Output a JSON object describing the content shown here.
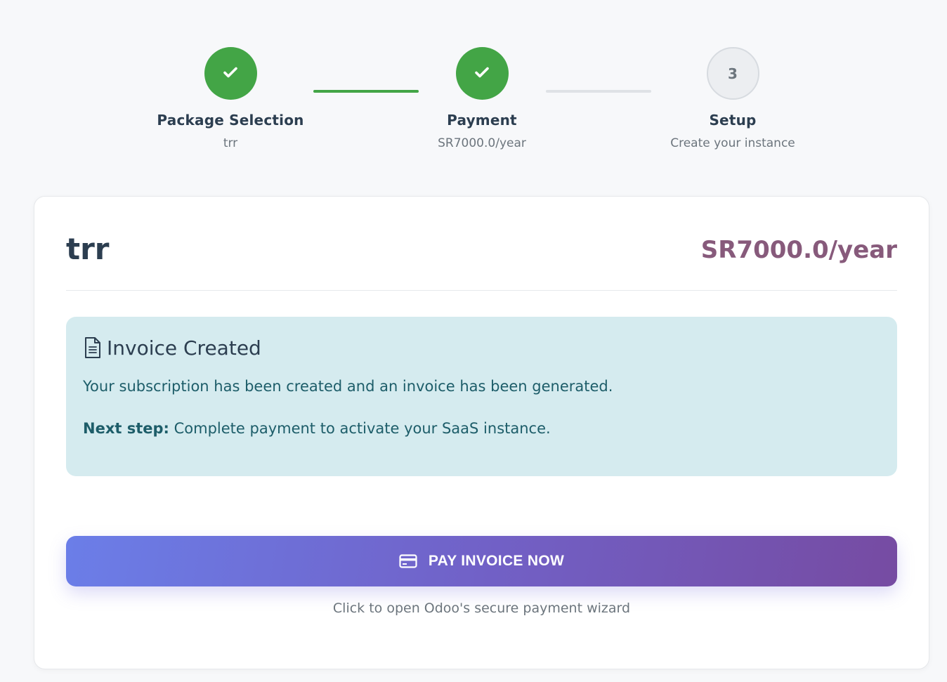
{
  "stepper": {
    "steps": [
      {
        "state": "done",
        "title": "Package Selection",
        "subtitle": "trr"
      },
      {
        "state": "done",
        "title": "Payment",
        "subtitle": "SR7000.0/year"
      },
      {
        "state": "pending",
        "number": "3",
        "title": "Setup",
        "subtitle": "Create your instance"
      }
    ],
    "icons": {
      "done": "check-icon"
    }
  },
  "package": {
    "name": "trr",
    "price": "SR7000.0/year"
  },
  "alert": {
    "icon": "document-icon",
    "title": "Invoice Created",
    "message": "Your subscription has been created and an invoice has been generated.",
    "next_label": "Next step:",
    "next_text": " Complete payment to activate your SaaS instance."
  },
  "pay_button": {
    "icon": "credit-card-icon",
    "label": "PAY INVOICE NOW"
  },
  "pay_hint": "Click to open Odoo's secure payment wizard",
  "colors": {
    "success": "#43a546",
    "price": "#875a7b",
    "alert_bg": "#d5ebef",
    "alert_text": "#1d5d69",
    "button_gradient_start": "#6b7ee8",
    "button_gradient_end": "#764ba2"
  }
}
